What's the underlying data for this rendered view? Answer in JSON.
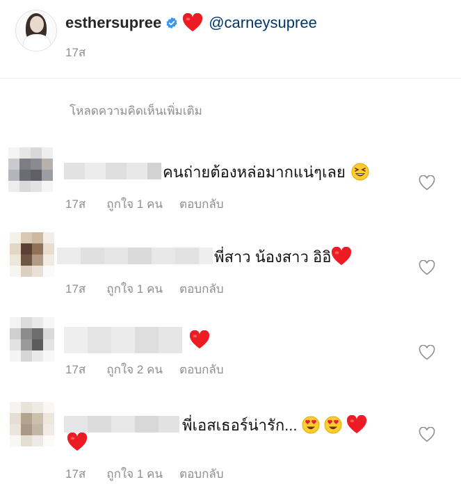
{
  "post": {
    "username": "esthersupree",
    "mention": "@carneysupree",
    "time": "17ส"
  },
  "load_more": "โหลดความคิดเห็นเพิ่มเติม",
  "comments": [
    {
      "text": "คนถ่ายต้องหล่อมากแน่ๆเลย",
      "time": "17ส",
      "likes": "ถูกใจ 1 คน",
      "reply": "ตอบกลับ"
    },
    {
      "text": "พี่สาว น้องสาว อิอิ",
      "time": "17ส",
      "likes": "ถูกใจ 1 คน",
      "reply": "ตอบกลับ"
    },
    {
      "text": "",
      "time": "17ส",
      "likes": "ถูกใจ 2 คน",
      "reply": "ตอบกลับ"
    },
    {
      "text": "พี่เอสเธอร์น่ารัก...",
      "time": "17ส",
      "likes": "ถูกใจ 1 คน",
      "reply": "ตอบกลับ"
    }
  ],
  "colors": {
    "heart": "#ed1c24",
    "verified": "#3897f0",
    "muted": "#8e8e8e",
    "mention": "#00376b"
  },
  "icons": [
    "verified-icon",
    "red-heart-emoji",
    "laughing-emoji",
    "heart-eyes-emoji",
    "heart-outline-icon"
  ]
}
